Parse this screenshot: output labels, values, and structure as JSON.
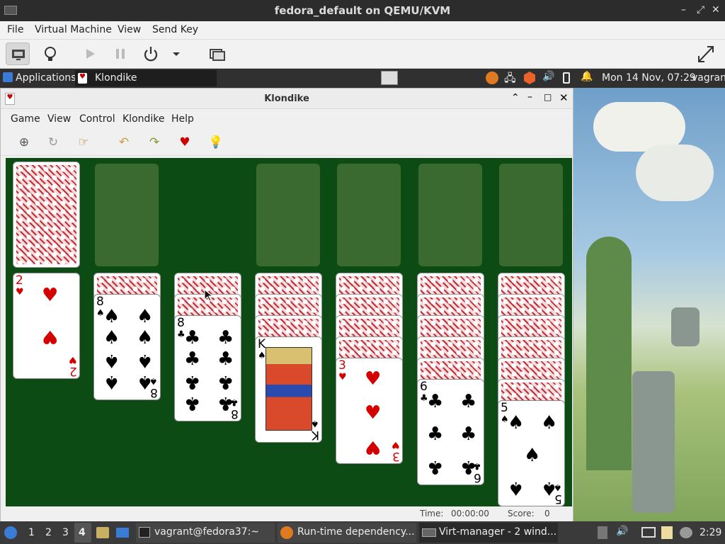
{
  "host": {
    "title": "fedora_default on QEMU/KVM",
    "menu": [
      "File",
      "Virtual Machine",
      "View",
      "Send Key"
    ]
  },
  "guest_panel": {
    "applications": "Applications",
    "active_window": "Klondike",
    "clock": "Mon 14 Nov, 07:29",
    "user": "vagrant"
  },
  "window": {
    "title": "Klondike",
    "menu": [
      "Game",
      "View",
      "Control",
      "Klondike",
      "Help"
    ],
    "status": {
      "time_label": "Time:",
      "time_value": "00:00:00",
      "score_label": "Score:",
      "score_value": "0"
    }
  },
  "tableau": {
    "columns": [
      {
        "face_down": 0,
        "card": {
          "rank": "2",
          "suit": "♥"
        }
      },
      {
        "face_down": 1,
        "card": {
          "rank": "8",
          "suit": "♠"
        }
      },
      {
        "face_down": 2,
        "card": {
          "rank": "8",
          "suit": "♣"
        }
      },
      {
        "face_down": 3,
        "card": {
          "rank": "K",
          "suit": "♠"
        }
      },
      {
        "face_down": 4,
        "card": {
          "rank": "3",
          "suit": "♥"
        }
      },
      {
        "face_down": 5,
        "card": {
          "rank": "6",
          "suit": "♣"
        }
      },
      {
        "face_down": 6,
        "card": {
          "rank": "5",
          "suit": "♠"
        }
      }
    ]
  },
  "taskbar": {
    "workspaces": [
      "1",
      "2",
      "3",
      "4"
    ],
    "tasks": [
      "vagrant@fedora37:~",
      "Run-time dependency...",
      "Virt-manager - 2 wind..."
    ],
    "clock": "2:29"
  },
  "colors": {
    "felt": "#0c4c14",
    "slot": "#3d6b32",
    "red_suit": "#d40000"
  }
}
